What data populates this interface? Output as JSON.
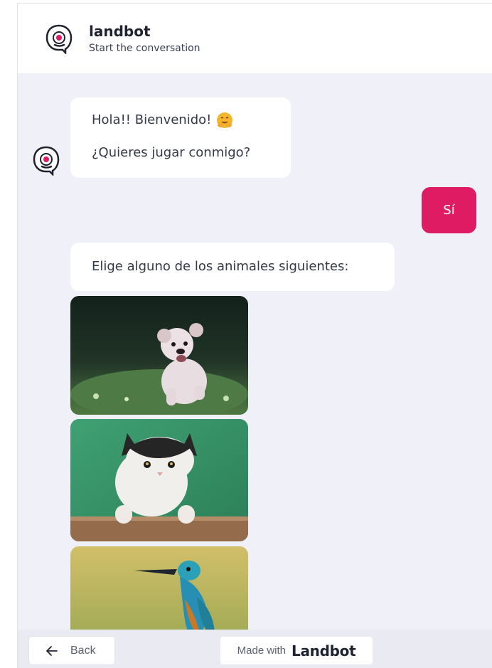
{
  "header": {
    "bot_name": "landbot",
    "subtitle": "Start the conversation",
    "logo_icon": "landbot-logo-icon"
  },
  "messages": {
    "greeting_line_1": "Hola!! Bienvenido!",
    "greeting_line_2": "¿Quieres jugar conmigo?",
    "greeting_emoji": "hugging-face-emoji",
    "user_reply": "Sí",
    "prompt": "Elige alguno de los animales siguientes:",
    "choices": [
      "dog-image",
      "cat-image",
      "bird-image"
    ]
  },
  "footer": {
    "back_label": "Back",
    "made_with_label": "Made with",
    "brand_label": "Landbot"
  },
  "colors": {
    "accent": "#df1b63",
    "chat_background": "#eff0f8",
    "header_background": "#ffffff"
  }
}
